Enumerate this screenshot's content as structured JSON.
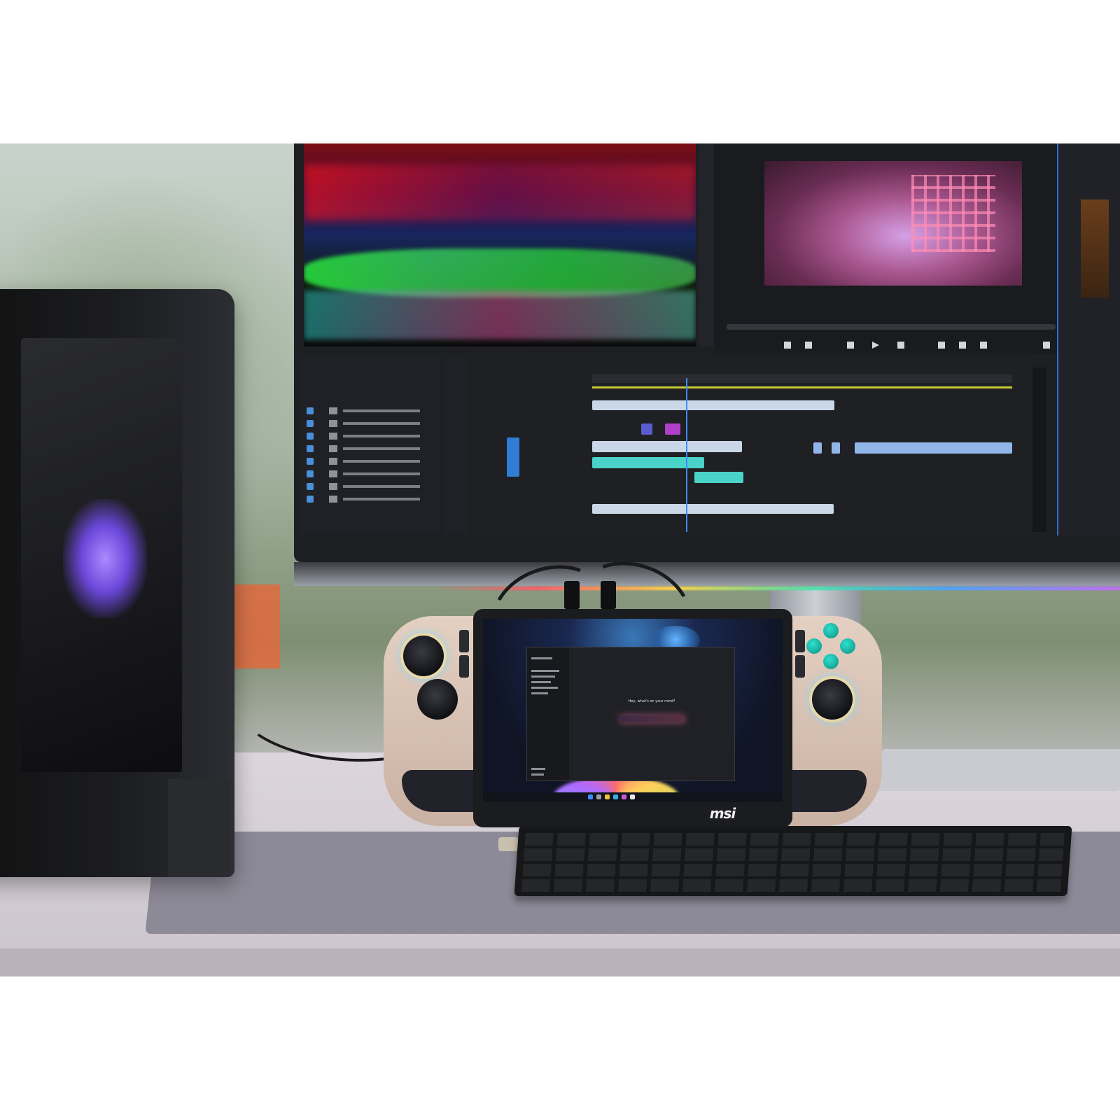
{
  "scene": {
    "description_label": "",
    "brand_logo": "msi"
  },
  "handheld": {
    "screen_app": {
      "prompt_heading": "Hey, what's on your mind?",
      "prompt_subtext": "",
      "input_placeholder": ""
    }
  },
  "colors": {
    "accent_blue": "#2f7dd4",
    "clip_teal": "#4ad3c8",
    "face_buttons": "#2ee0cc",
    "rgb_strip": [
      "#ff5a6b",
      "#ffd44a",
      "#48e0a8",
      "#4aa3ff",
      "#c46bff"
    ]
  },
  "icons": [
    "face-button-icon",
    "joystick-icon",
    "play-icon",
    "windows-start-icon"
  ]
}
